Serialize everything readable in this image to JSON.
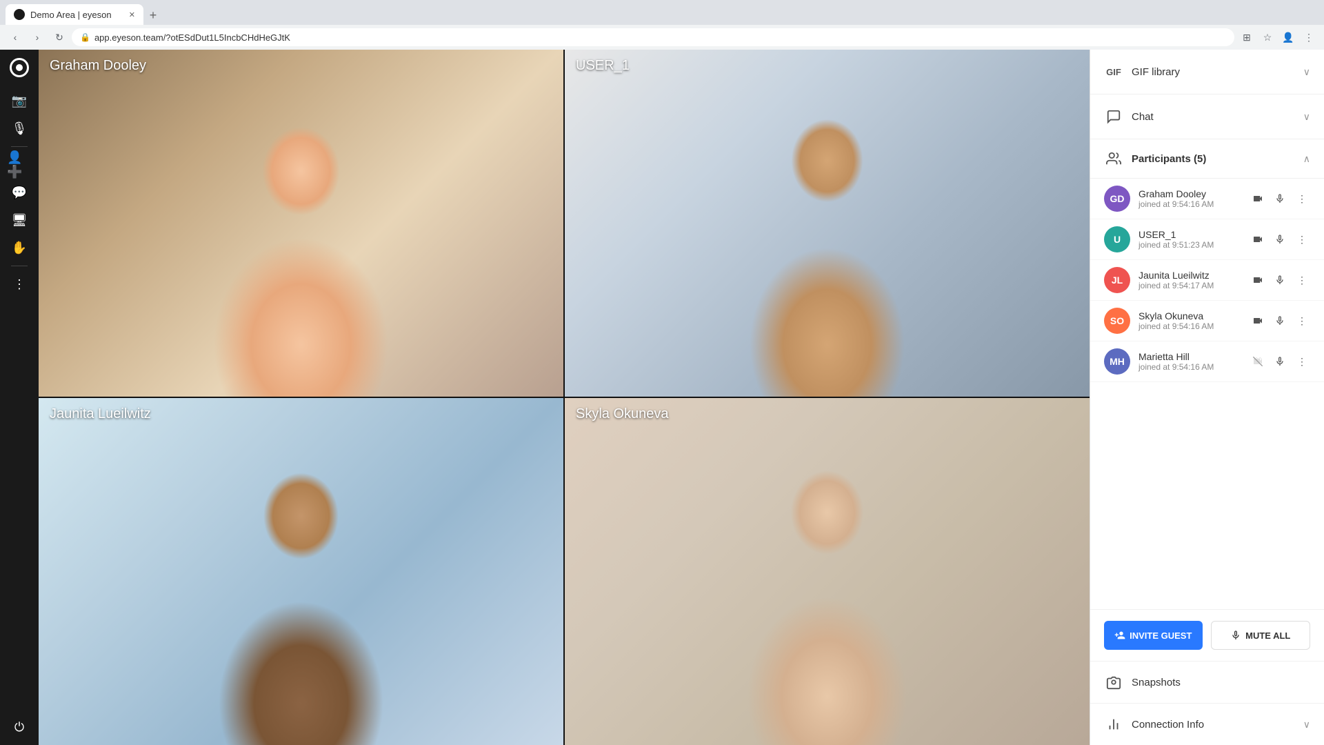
{
  "browser": {
    "tab_title": "Demo Area | eyeson",
    "tab_favicon": "●",
    "url": "app.eyeson.team/?otESdDut1L5IncbCHdHeGJtK",
    "new_tab_label": "+"
  },
  "sidebar": {
    "logo_alt": "eyeson logo",
    "icons": [
      {
        "name": "camera",
        "symbol": "📷"
      },
      {
        "name": "microphone",
        "symbol": "🎤"
      },
      {
        "name": "add-user",
        "symbol": "👤"
      },
      {
        "name": "chat-bubble",
        "symbol": "💬"
      },
      {
        "name": "screen-share",
        "symbol": "🖥"
      },
      {
        "name": "hand-raise",
        "symbol": "✋"
      },
      {
        "name": "more",
        "symbol": "⋮"
      }
    ]
  },
  "video_grid": {
    "cells": [
      {
        "id": 1,
        "label": "Graham Dooley"
      },
      {
        "id": 2,
        "label": "USER_1"
      },
      {
        "id": 3,
        "label": "Jaunita Lueilwitz"
      },
      {
        "id": 4,
        "label": "Skyla Okuneva"
      }
    ]
  },
  "right_panel": {
    "gif_section": {
      "icon": "GIF",
      "label": "GIF library",
      "expanded": false
    },
    "chat_section": {
      "label": "Chat",
      "expanded": false
    },
    "participants_section": {
      "label": "Participants (5)",
      "count": 5,
      "expanded": true,
      "participants": [
        {
          "initials": "GD",
          "name": "Graham Dooley",
          "joined": "joined at 9:54:16 AM",
          "avatar_class": "av-gd",
          "has_video": true,
          "has_audio": true
        },
        {
          "initials": "U",
          "name": "USER_1",
          "joined": "joined at 9:51:23 AM",
          "avatar_class": "av-u1",
          "has_video": true,
          "has_audio": true
        },
        {
          "initials": "JL",
          "name": "Jaunita Lueilwitz",
          "joined": "joined at 9:54:17 AM",
          "avatar_class": "av-jl",
          "has_video": true,
          "has_audio": true
        },
        {
          "initials": "SO",
          "name": "Skyla Okuneva",
          "joined": "joined at 9:54:16 AM",
          "avatar_class": "av-so",
          "has_video": true,
          "has_audio": true
        },
        {
          "initials": "MH",
          "name": "Marietta Hill",
          "joined": "joined at 9:54:16 AM",
          "avatar_class": "av-mh",
          "has_video": false,
          "has_audio": true
        }
      ]
    },
    "invite_guest_label": "INVITE GUEST",
    "mute_all_label": "MUTE ALL",
    "snapshots_label": "Snapshots",
    "connection_info_label": "Connection Info"
  }
}
